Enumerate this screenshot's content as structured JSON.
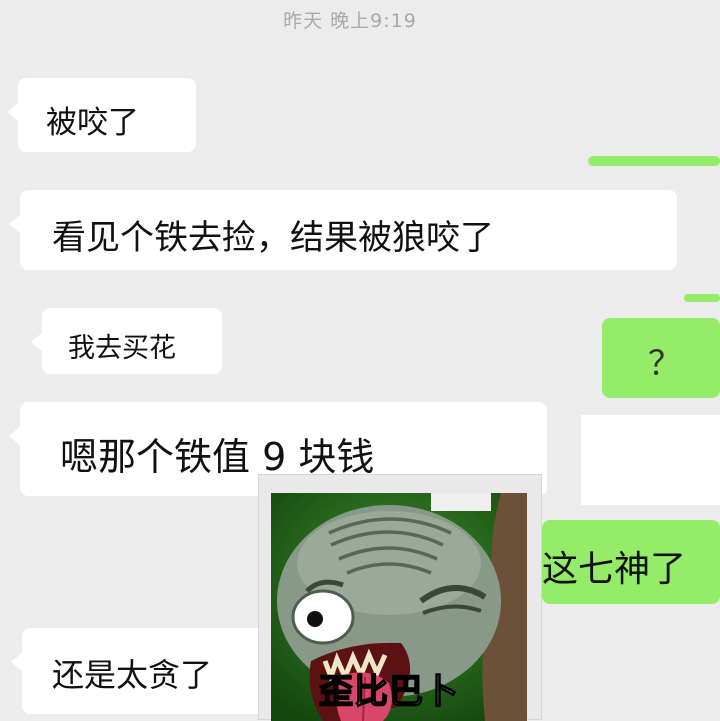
{
  "timestamp": "昨天 晚上9:19",
  "messages": [
    {
      "side": "left",
      "text": "被咬了"
    },
    {
      "side": "left",
      "text": "看见个铁去捡，结果被狼咬了"
    },
    {
      "side": "left",
      "text": "我去买花"
    },
    {
      "side": "left",
      "text": "嗯那个铁值 9 块钱"
    },
    {
      "side": "right",
      "text": "？"
    },
    {
      "side": "right",
      "text": "这七神了"
    },
    {
      "side": "left",
      "text": "还是太贪了"
    }
  ],
  "sticker": {
    "caption": "歪比巴卜"
  },
  "colors": {
    "background": "#ececec",
    "bubble_left": "#ffffff",
    "bubble_right": "#95ec69"
  }
}
